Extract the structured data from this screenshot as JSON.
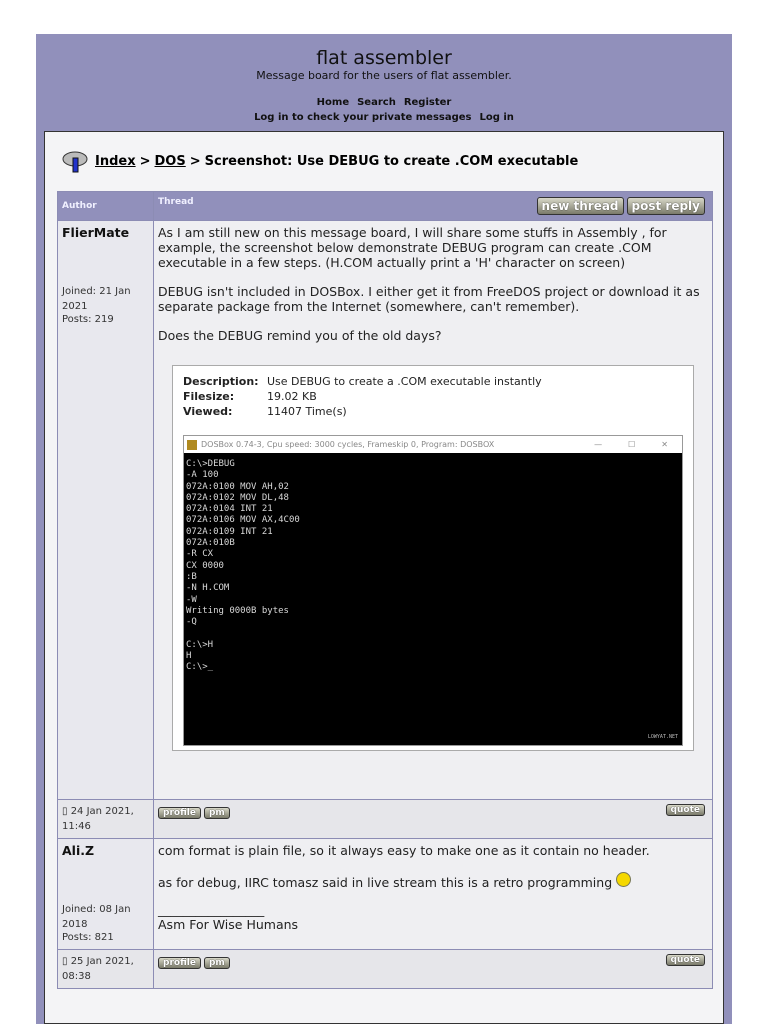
{
  "header": {
    "title": "flat assembler",
    "subtitle": "Message board for the users of flat assembler.",
    "nav": [
      "Home",
      "Search",
      "Register"
    ],
    "nav2": [
      "Log in to check your private messages",
      "Log in"
    ]
  },
  "breadcrumb": {
    "index": "Index",
    "sep": ">",
    "forum": "DOS",
    "topic": "Screenshot: Use DEBUG to create .COM executable"
  },
  "table": {
    "author_header": "Author",
    "thread_header": "Thread",
    "new_thread": "new thread",
    "post_reply": "post reply"
  },
  "posts": [
    {
      "author": "FlierMate",
      "joined": "Joined: 21 Jan 2021",
      "posts": "Posts: 219",
      "date": "24 Jan 2021, 11:46",
      "paragraphs": [
        "As I am still new on this message board, I will share some stuffs in Assembly , for example, the screenshot below demonstrate DEBUG program can create .COM executable in a few steps. (H.COM actually print a 'H' character on screen)",
        "DEBUG isn't included in DOSBox. I either get it from FreeDOS project or download it as separate package from the Internet (somewhere, can't remember).",
        "Does the DEBUG remind you of the old days?"
      ],
      "attachment": {
        "description_label": "Description:",
        "description": "Use DEBUG to create a .COM executable instantly",
        "filesize_label": "Filesize:",
        "filesize": "19.02 KB",
        "viewed_label": "Viewed:",
        "viewed": "11407 Time(s)",
        "window_title": "DOSBox 0.74-3, Cpu speed:    3000 cycles, Frameskip  0, Program:  DOSBOX",
        "console": "C:\\>DEBUG\n-A 100\n072A:0100 MOV AH,02\n072A:0102 MOV DL,48\n072A:0104 INT 21\n072A:0106 MOV AX,4C00\n072A:0109 INT 21\n072A:010B\n-R CX\nCX 0000\n:B\n-N H.COM\n-W\nWriting 0000B bytes\n-Q\n\nC:\\>H\nH\nC:\\>_",
        "watermark": "LOWYAT.NET"
      }
    },
    {
      "author": "Ali.Z",
      "joined": "Joined: 08 Jan 2018",
      "posts": "Posts: 821",
      "date": "25 Jan 2021, 08:38",
      "paragraphs": [
        "com format is plain file, so it always easy to make one as it contain no header.",
        "as for debug, IIRC tomasz said in live stream this is a retro programming"
      ],
      "signature_rule": "_________________",
      "signature": "Asm For Wise Humans"
    }
  ],
  "buttons": {
    "profile": "profile",
    "pm": "pm",
    "quote": "quote"
  },
  "colors": {
    "frame": "#9190bb"
  }
}
